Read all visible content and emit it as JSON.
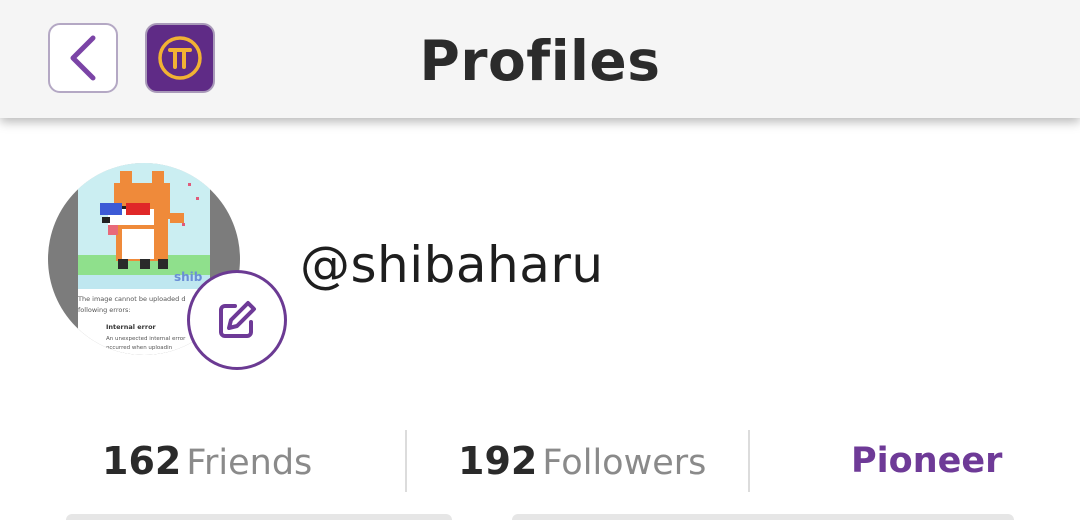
{
  "header": {
    "title": "Profiles",
    "back_icon": "chevron-left-icon",
    "logo_icon": "pi-network-logo-icon"
  },
  "avatar": {
    "image_name": "shiba-pixel-art-avatar",
    "overlay_text": "shib",
    "error_line1": "The image cannot be uploaded d",
    "error_line2": "following errors:",
    "error_title": "Internal error",
    "error_detail1": "An unexpected internal error",
    "error_detail2": "occurred when uploadin"
  },
  "edit_icon": "pencil-square-icon",
  "profile": {
    "username": "@shibaharu"
  },
  "stats": {
    "friends_count": "162",
    "friends_label": "Friends",
    "followers_count": "192",
    "followers_label": "Followers",
    "role": "Pioneer"
  },
  "colors": {
    "accent": "#6e3a97",
    "logo_bg": "#5f2b86",
    "logo_gold": "#f2b233",
    "header_bg": "#f5f5f5"
  }
}
